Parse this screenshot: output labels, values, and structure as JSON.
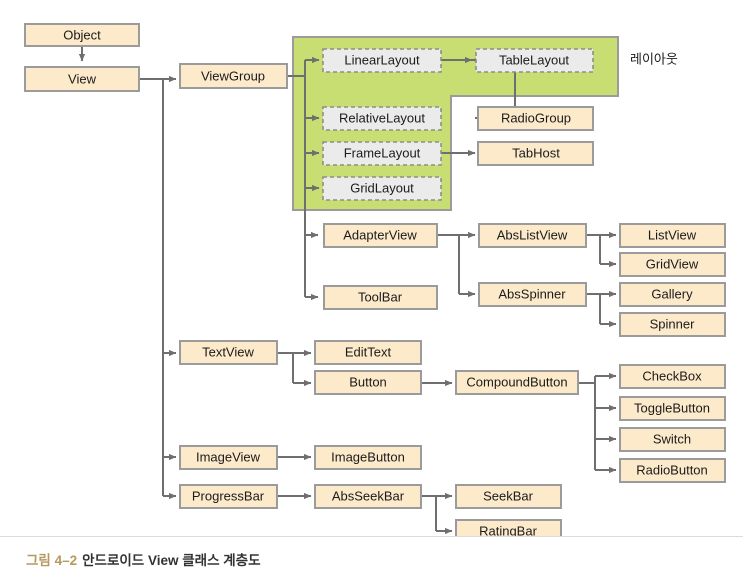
{
  "figure": {
    "caption_number": "그림 4–2",
    "caption_title": "안드로이드 View 클래스 계층도",
    "group_annotation": "레이아웃",
    "colors": {
      "node_fill": "#fdeacb",
      "node_border": "#9b9b9b",
      "dashed_node_fill": "#ebebeb",
      "dashed_node_border": "#8d8d8d",
      "group_fill": "#c9de72",
      "connector": "#6f6f6f",
      "caption_number_color": "#b49a5e",
      "caption_text_color": "#333333",
      "background": "#ffffff"
    }
  },
  "nodes": {
    "object": "Object",
    "view": "View",
    "viewgroup": "ViewGroup",
    "linearlayout": "LinearLayout",
    "tablelayout": "TableLayout",
    "relativelayout": "RelativeLayout",
    "radiogroup": "RadioGroup",
    "framelayout": "FrameLayout",
    "tabhost": "TabHost",
    "gridlayout": "GridLayout",
    "adapterview": "AdapterView",
    "abslistview": "AbsListView",
    "listview": "ListView",
    "gridview": "GridView",
    "toolbar": "ToolBar",
    "absspinner": "AbsSpinner",
    "gallery": "Gallery",
    "spinner": "Spinner",
    "textview": "TextView",
    "edittext": "EditText",
    "button": "Button",
    "compoundbutton": "CompoundButton",
    "checkbox": "CheckBox",
    "togglebutton": "ToggleButton",
    "switch": "Switch",
    "radiobutton": "RadioButton",
    "imageview": "ImageView",
    "imagebutton": "ImageButton",
    "progressbar": "ProgressBar",
    "absseekbar": "AbsSeekBar",
    "seekbar": "SeekBar",
    "ratingbar": "RatingBar"
  },
  "hierarchy": {
    "root": "Object",
    "edges": [
      [
        "Object",
        "View"
      ],
      [
        "View",
        "ViewGroup"
      ],
      [
        "View",
        "TextView"
      ],
      [
        "View",
        "ImageView"
      ],
      [
        "View",
        "ProgressBar"
      ],
      [
        "ViewGroup",
        "LinearLayout"
      ],
      [
        "ViewGroup",
        "RelativeLayout"
      ],
      [
        "ViewGroup",
        "FrameLayout"
      ],
      [
        "ViewGroup",
        "GridLayout"
      ],
      [
        "ViewGroup",
        "AdapterView"
      ],
      [
        "ViewGroup",
        "ToolBar"
      ],
      [
        "LinearLayout",
        "TableLayout"
      ],
      [
        "LinearLayout",
        "RadioGroup"
      ],
      [
        "FrameLayout",
        "TabHost"
      ],
      [
        "AdapterView",
        "AbsListView"
      ],
      [
        "AdapterView",
        "AbsSpinner"
      ],
      [
        "AbsListView",
        "ListView"
      ],
      [
        "AbsListView",
        "GridView"
      ],
      [
        "AbsSpinner",
        "Gallery"
      ],
      [
        "AbsSpinner",
        "Spinner"
      ],
      [
        "TextView",
        "EditText"
      ],
      [
        "TextView",
        "Button"
      ],
      [
        "Button",
        "CompoundButton"
      ],
      [
        "CompoundButton",
        "CheckBox"
      ],
      [
        "CompoundButton",
        "ToggleButton"
      ],
      [
        "CompoundButton",
        "Switch"
      ],
      [
        "CompoundButton",
        "RadioButton"
      ],
      [
        "ImageView",
        "ImageButton"
      ],
      [
        "ProgressBar",
        "AbsSeekBar"
      ],
      [
        "AbsSeekBar",
        "SeekBar"
      ],
      [
        "AbsSeekBar",
        "RatingBar"
      ]
    ],
    "layout_group_members": [
      "LinearLayout",
      "TableLayout",
      "RelativeLayout",
      "FrameLayout",
      "GridLayout"
    ]
  }
}
